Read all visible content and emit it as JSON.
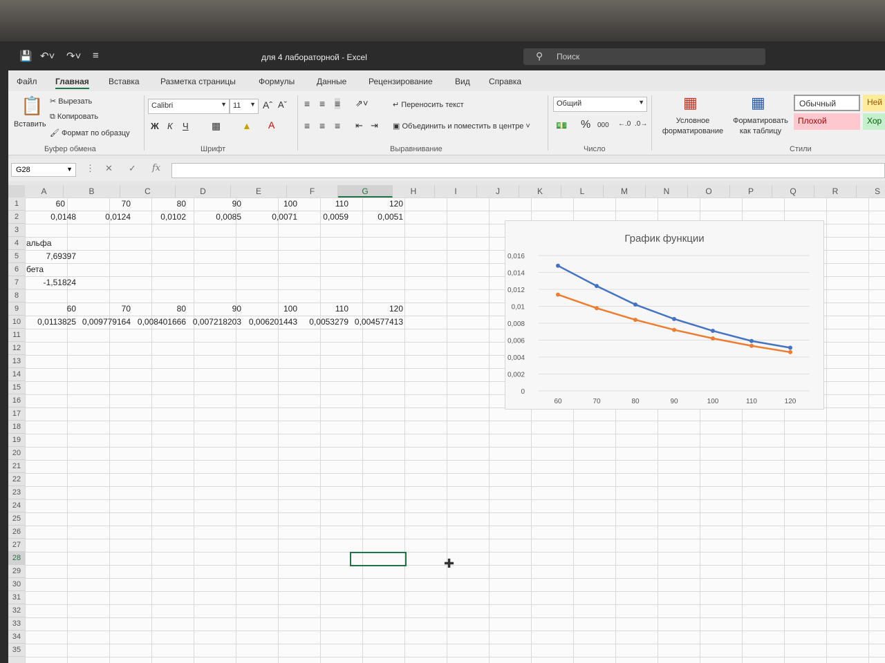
{
  "titlebar": {
    "title": "для 4 лабораторной  -  Excel",
    "search_placeholder": "Поиск"
  },
  "menu": [
    "Файл",
    "Главная",
    "Вставка",
    "Разметка страницы",
    "Формулы",
    "Данные",
    "Рецензирование",
    "Вид",
    "Справка"
  ],
  "ribbon": {
    "paste": "Вставить",
    "cut": "Вырезать",
    "copy": "Копировать",
    "format_painter": "Формат по образцу",
    "clipboard_group": "Буфер обмена",
    "font_name": "Calibri",
    "font_size": "11",
    "bold": "Ж",
    "italic": "К",
    "underline": "Ч",
    "font_group": "Шрифт",
    "wrap_text": "Переносить текст",
    "merge_center": "Объединить и поместить в центре",
    "alignment_group": "Выравнивание",
    "number_format": "Общий",
    "percent": "%",
    "thousands": "000",
    "number_group": "Число",
    "conditional_formatting": "Условное форматирование",
    "format_as_table": "Форматировать как таблицу",
    "style_normal": "Обычный",
    "style_bad": "Плохой",
    "style_neutral": "Ней",
    "style_good": "Хор",
    "styles_group": "Стили"
  },
  "formula_bar": {
    "name_box": "G28",
    "fx": "fx",
    "formula": ""
  },
  "columns": [
    "A",
    "B",
    "C",
    "D",
    "E",
    "F",
    "G",
    "H",
    "I",
    "J",
    "K",
    "L",
    "M",
    "N",
    "O",
    "P",
    "Q",
    "R",
    "S"
  ],
  "selected_column": "G",
  "rows": [
    "1",
    "2",
    "3",
    "4",
    "5",
    "6",
    "7",
    "8",
    "9",
    "10",
    "11",
    "12",
    "13",
    "14",
    "15",
    "16",
    "17",
    "18",
    "19",
    "20",
    "21",
    "22",
    "23",
    "24",
    "25",
    "26",
    "27",
    "28",
    "29",
    "30",
    "31",
    "32",
    "33",
    "34",
    "35"
  ],
  "cells": {
    "row1": [
      "60",
      "70",
      "80",
      "90",
      "100",
      "110",
      "120"
    ],
    "row2": [
      "0,0148",
      "0,0124",
      "0,0102",
      "0,0085",
      "0,0071",
      "0,0059",
      "0,0051"
    ],
    "A4": "альфа",
    "A5": "7,69397",
    "A6": "бета",
    "A7": "-1,51824",
    "row9": [
      "60",
      "70",
      "80",
      "90",
      "100",
      "110",
      "120"
    ],
    "row10": [
      "0,0113825",
      "0,009779164",
      "0,008401666",
      "0,007218203",
      "0,006201443",
      "0,0053279",
      "0,004577413"
    ]
  },
  "chart_data": {
    "type": "line",
    "title": "График функции",
    "categories": [
      "60",
      "70",
      "80",
      "90",
      "100",
      "110",
      "120"
    ],
    "series": [
      {
        "values": [
          0.0148,
          0.0124,
          0.0102,
          0.0085,
          0.0071,
          0.0059,
          0.0051
        ],
        "color": "#4472c4"
      },
      {
        "values": [
          0.0113825,
          0.009779164,
          0.008401666,
          0.007218203,
          0.006201443,
          0.0053279,
          0.004577413
        ],
        "color": "#ed7d31"
      }
    ],
    "yticks": [
      "0",
      "0,002",
      "0,004",
      "0,006",
      "0,008",
      "0,01",
      "0,012",
      "0,014",
      "0,016"
    ],
    "ylim": [
      0,
      0.016
    ],
    "grid": true,
    "legend": "none"
  }
}
